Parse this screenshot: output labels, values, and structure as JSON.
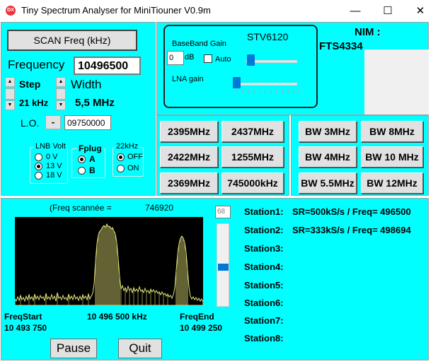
{
  "window": {
    "title": "Tiny Spectrum Analyser for MiniTiouner V0.9m",
    "icon_text": "DX",
    "minimize_glyph": "—",
    "maximize_glyph": "☐",
    "close_glyph": "✕"
  },
  "controls": {
    "scan_button": "SCAN Freq (kHz)",
    "frequency_label": "Frequency",
    "frequency_value": "10496500",
    "step_label": "Step",
    "step_value": "21 kHz",
    "width_label": "Width",
    "width_value": "5,5 MHz",
    "lo_label": "L.O.",
    "lo_sign": "-",
    "lo_value": "09750000"
  },
  "lnb": {
    "title": "LNB Volt",
    "options": [
      "0 V",
      "13 V",
      "18 V"
    ],
    "selected": "13 V"
  },
  "fplug": {
    "title": "Fplug",
    "options": [
      "A",
      "B"
    ],
    "selected": "A"
  },
  "khz22": {
    "title": "22kHz",
    "options": [
      "OFF",
      "ON"
    ],
    "selected": "OFF"
  },
  "stv": {
    "chip": "STV6120",
    "baseband_label": "BaseBand Gain",
    "baseband_value": "0",
    "db_label": "dB",
    "auto_label": "Auto",
    "auto_checked": false,
    "lna_label": "LNA gain"
  },
  "nim": {
    "label": "NIM :",
    "model": "FTS4334"
  },
  "freq_buttons": [
    "2395MHz",
    "2437MHz",
    "2422MHz",
    "1255MHz",
    "2369MHz",
    "745000kHz"
  ],
  "bw_buttons": [
    "BW 3MHz",
    "BW 8MHz",
    "BW 4MHz",
    "BW 10 MHz",
    "BW 5.5MHz",
    "BW 12MHz"
  ],
  "spectrum": {
    "scanned_label": "(Freq scannée =",
    "scanned_value": "746920",
    "level_value": "68",
    "freq_start_label": "FreqStart",
    "freq_start_value": "10 493 750",
    "center_value": "10 496 500 kHz",
    "freq_end_label": "FreqEnd",
    "freq_end_value": "10 499 250"
  },
  "stations": [
    {
      "label": "Station1:",
      "value": "SR=500kS/s / Freq= 496500"
    },
    {
      "label": "Station2:",
      "value": "SR=333kS/s / Freq= 498694"
    },
    {
      "label": "Station3:",
      "value": ""
    },
    {
      "label": "Station4:",
      "value": ""
    },
    {
      "label": "Station5:",
      "value": ""
    },
    {
      "label": "Station6:",
      "value": ""
    },
    {
      "label": "Station7:",
      "value": ""
    },
    {
      "label": "Station8:",
      "value": ""
    }
  ],
  "actions": {
    "pause": "Pause",
    "quit": "Quit"
  },
  "colors": {
    "panel": "#00ffff",
    "spectrum_bg": "#000000",
    "spectrum_trace": "#e6e67a",
    "accent": "#0078d7"
  }
}
